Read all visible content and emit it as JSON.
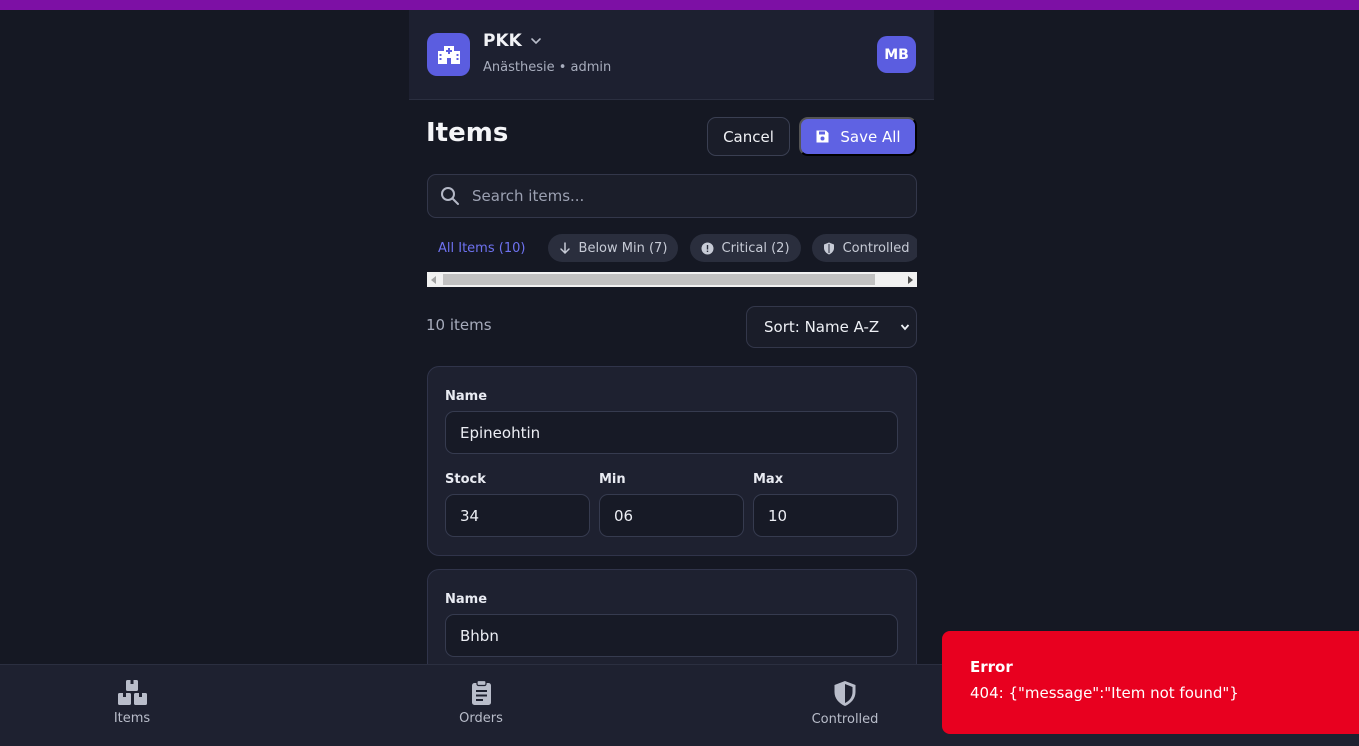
{
  "header": {
    "hospital_name": "PKK",
    "subtitle": "Anästhesie • admin",
    "avatar_initials": "MB"
  },
  "page": {
    "title": "Items",
    "cancel_label": "Cancel",
    "save_label": "Save All"
  },
  "search": {
    "placeholder": "Search items..."
  },
  "filters": [
    {
      "label": "All Items (10)",
      "active": true
    },
    {
      "label": "Below Min (7)",
      "icon": "arrow-down-icon"
    },
    {
      "label": "Critical (2)",
      "icon": "alert-circle-icon"
    },
    {
      "label": "Controlled",
      "icon": "shield-icon"
    }
  ],
  "list": {
    "count_label": "10 items",
    "sort_label": "Sort: Name A-Z"
  },
  "items": [
    {
      "name_label": "Name",
      "name": "Epineohtin",
      "stock_label": "Stock",
      "stock": "34",
      "min_label": "Min",
      "min": "06",
      "max_label": "Max",
      "max": "10"
    },
    {
      "name_label": "Name",
      "name": "Bhbn"
    }
  ],
  "bottom_nav": [
    {
      "label": "Items",
      "icon": "items-icon"
    },
    {
      "label": "Orders",
      "icon": "clipboard-icon"
    },
    {
      "label": "Controlled",
      "icon": "shield-icon"
    }
  ],
  "toast": {
    "title": "Error",
    "message": "404: {\"message\":\"Item not found\"}"
  },
  "colors": {
    "accent": "#5f62e3",
    "error": "#e8001f",
    "top_bar": "#7d10a5",
    "background": "#151823"
  }
}
